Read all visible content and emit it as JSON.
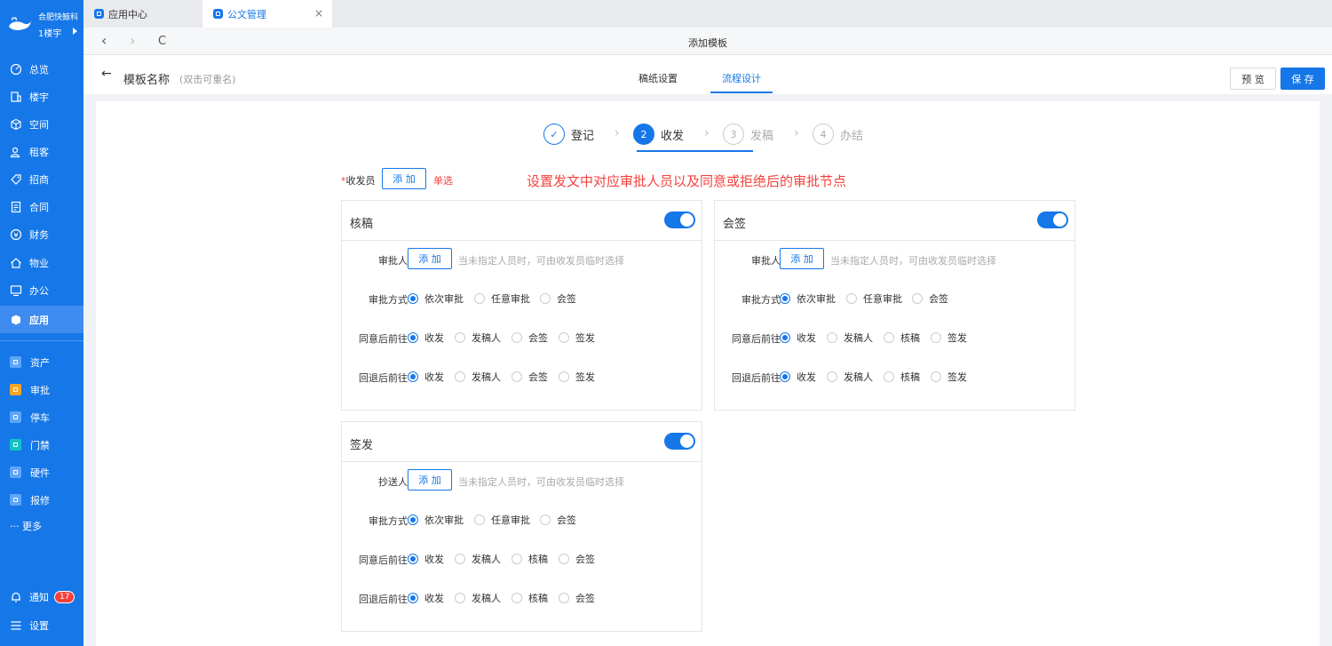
{
  "sidebar": {
    "org": "合肥快鲸科",
    "building": "1楼宇",
    "items": [
      {
        "label": "总览",
        "icon": "dashboard-icon"
      },
      {
        "label": "楼宇",
        "icon": "building-icon"
      },
      {
        "label": "空间",
        "icon": "cube-icon"
      },
      {
        "label": "租客",
        "icon": "users-icon"
      },
      {
        "label": "招商",
        "icon": "tag-icon"
      },
      {
        "label": "合同",
        "icon": "document-icon"
      },
      {
        "label": "财务",
        "icon": "coin-icon"
      },
      {
        "label": "物业",
        "icon": "home-icon"
      },
      {
        "label": "办公",
        "icon": "monitor-icon"
      },
      {
        "label": "应用",
        "icon": "app-icon"
      }
    ],
    "apps": [
      {
        "label": "资产",
        "color": "#5ea6f7"
      },
      {
        "label": "审批",
        "color": "#f5a623"
      },
      {
        "label": "停车",
        "color": "#5ea6f7"
      },
      {
        "label": "门禁",
        "color": "#13c2c2"
      },
      {
        "label": "硬件",
        "color": "#5ea6f7"
      },
      {
        "label": "报修",
        "color": "#5ea6f7"
      }
    ],
    "more": "··· 更多",
    "notify": "通知",
    "notify_count": "17",
    "settings": "设置"
  },
  "tabs": [
    {
      "label": "应用中心",
      "active": false
    },
    {
      "label": "公文管理",
      "active": true,
      "close": "×"
    }
  ],
  "address": {
    "back": "‹",
    "forward": "›",
    "reload": "C",
    "title": "添加模板"
  },
  "header": {
    "back": "←",
    "template_name": "模板名称",
    "rename_hint": "(双击可重名)",
    "tabs": [
      "稿纸设置",
      "流程设计"
    ],
    "preview": "预 览",
    "save": "保 存"
  },
  "steps": [
    {
      "num": "✓",
      "label": "登记",
      "state": "done"
    },
    {
      "num": "2",
      "label": "收发",
      "state": "current"
    },
    {
      "num": "3",
      "label": "发稿",
      "state": "wait"
    },
    {
      "num": "4",
      "label": "办结",
      "state": "wait"
    }
  ],
  "dispatcher": {
    "label": "收发员",
    "add": "添 加",
    "single": "单选",
    "annotation": "设置发文中对应审批人员以及同意或拒绝后的审批节点"
  },
  "cards": [
    {
      "title": "核稿",
      "person_label": "审批人",
      "add": "添 加",
      "placeholder": "当未指定人员时，可由收发员临时选择",
      "method_label": "审批方式",
      "methods": [
        "依次审批",
        "任意审批",
        "会签"
      ],
      "agree_label": "同意后前往",
      "agree": [
        "收发",
        "发稿人",
        "会签",
        "签发"
      ],
      "reject_label": "回退后前往",
      "reject": [
        "收发",
        "发稿人",
        "会签",
        "签发"
      ]
    },
    {
      "title": "会签",
      "person_label": "审批人",
      "add": "添 加",
      "placeholder": "当未指定人员时，可由收发员临时选择",
      "method_label": "审批方式",
      "methods": [
        "依次审批",
        "任意审批",
        "会签"
      ],
      "agree_label": "同意后前往",
      "agree": [
        "收发",
        "发稿人",
        "核稿",
        "签发"
      ],
      "reject_label": "回退后前往",
      "reject": [
        "收发",
        "发稿人",
        "核稿",
        "签发"
      ]
    },
    {
      "title": "签发",
      "person_label": "抄送人",
      "add": "添 加",
      "placeholder": "当未指定人员时，可由收发员临时选择",
      "method_label": "审批方式",
      "methods": [
        "依次审批",
        "任意审批",
        "会签"
      ],
      "agree_label": "同意后前往",
      "agree": [
        "收发",
        "发稿人",
        "核稿",
        "会签"
      ],
      "reject_label": "回退后前往",
      "reject": [
        "收发",
        "发稿人",
        "核稿",
        "会签"
      ]
    }
  ],
  "colors": {
    "primary": "#1677e8",
    "danger": "#f5413c",
    "sidebar": "#1677e8"
  }
}
